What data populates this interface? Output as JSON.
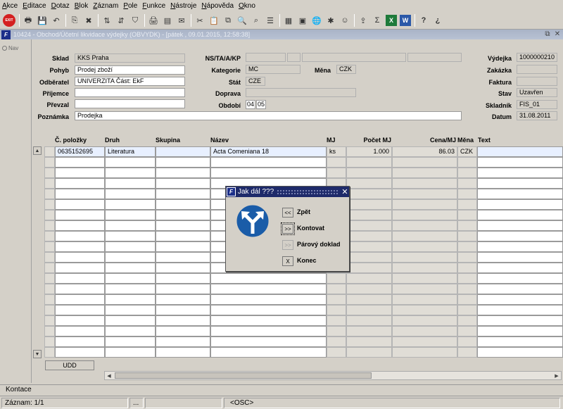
{
  "menu": [
    "Akce",
    "Editace",
    "Dotaz",
    "Blok",
    "Záznam",
    "Pole",
    "Funkce",
    "Nástroje",
    "Nápověda",
    "Okno"
  ],
  "toolbar": {
    "exit_label": "EXIT",
    "icons": [
      "print-icon",
      "save-icon",
      "undo-icon",
      "copy-record-icon",
      "delete-record-icon",
      "sort-icon",
      "sort-desc-icon",
      "filter-icon",
      "printer-icon",
      "report-icon",
      "mail-icon",
      "cut-icon",
      "paste-icon",
      "copy-icon",
      "find-icon",
      "zoom-icon",
      "lov-icon",
      "calc-icon",
      "calendar-icon",
      "globe-icon",
      "settings-icon",
      "contact-icon",
      "export-icon",
      "sigma-icon",
      "excel-icon",
      "word-icon",
      "help-icon",
      "context-help-icon"
    ],
    "glyphs": [
      "🖶",
      "💾",
      "↶",
      "⎘",
      "✖",
      "⇅",
      "⇵",
      "⛉",
      "🖨",
      "▤",
      "✉",
      "✂",
      "📋",
      "⧉",
      "🔍",
      "⌕",
      "☰",
      "▦",
      "▣",
      "🌐",
      "✱",
      "☺",
      "⇪",
      "Σ",
      "X",
      "W",
      "?",
      "¿"
    ]
  },
  "window": {
    "title": "10424 - Obchod/Účetní likvidace výdejky (OBVYDK) - [pátek , 09.01.2015, 12:58:38]",
    "app_icon": "F",
    "restore_glyph": "⧉",
    "close_glyph": "✕"
  },
  "nav": {
    "label": "Nav"
  },
  "form": {
    "sklad": {
      "label": "Sklad",
      "value": "KKS Praha"
    },
    "pohyb": {
      "label": "Pohyb",
      "value": "Prodej zboží"
    },
    "odberatel": {
      "label": "Odběratel",
      "value": "UNIVERZITA Část: EkF"
    },
    "prijemce": {
      "label": "Příjemce",
      "value": ""
    },
    "prevzal": {
      "label": "Převzal",
      "value": ""
    },
    "poznamka": {
      "label": "Poznámka",
      "value": "Prodejka"
    },
    "ns": {
      "label": "NS/TA/A/KP",
      "values": [
        "",
        "",
        "",
        ""
      ]
    },
    "kategorie": {
      "label": "Kategorie",
      "value": "MC"
    },
    "mena": {
      "label": "Měna",
      "value": "CZK"
    },
    "stat": {
      "label": "Stát",
      "value": "CZE"
    },
    "doprava": {
      "label": "Doprava",
      "value": ""
    },
    "obdobi": {
      "label": "Období",
      "year": "04",
      "month": "05"
    },
    "vydejka": {
      "label": "Výdejka",
      "value": "1000000210"
    },
    "zakazka": {
      "label": "Zakázka",
      "value": ""
    },
    "faktura": {
      "label": "Faktura",
      "value": ""
    },
    "stav": {
      "label": "Stav",
      "value": "Uzavřen"
    },
    "skladnik": {
      "label": "Skladník",
      "value": "FIS_01"
    },
    "datum": {
      "label": "Datum",
      "value": "31.08.2011"
    }
  },
  "grid": {
    "headers": {
      "polozka": "Č. položky",
      "druh": "Druh",
      "skupina": "Skupina",
      "nazev": "Název",
      "mj": "MJ",
      "pocet": "Počet MJ",
      "cena": "Cena/MJ",
      "mena": "Měna",
      "text": "Text"
    },
    "rows": [
      {
        "polozka": "0635152695",
        "druh": "Literatura",
        "skupina": "",
        "nazev": "Acta Comeniana 18",
        "mj": "ks",
        "pocet": "1.000",
        "cena": "86.03",
        "mena": "CZK",
        "text": ""
      }
    ],
    "scroll_up": "▲",
    "scroll_down": "▼",
    "scroll_left": "◀",
    "scroll_right": "▶"
  },
  "udd_button": "UDD",
  "status": {
    "block": "Kontace",
    "record": "Záznam: 1/1",
    "seg2": "...",
    "seg3": "",
    "osc": "<OSC>"
  },
  "dialog": {
    "title": "Jak dál ???",
    "app_icon": "F",
    "close_glyph": "✕",
    "options": [
      {
        "key": "<<",
        "label": "Zpět",
        "enabled": true
      },
      {
        "key": ">>",
        "label": "Kontovat",
        "enabled": true,
        "focused": true
      },
      {
        "key": ">>",
        "label": "Párový doklad",
        "enabled": false
      },
      {
        "key": "X",
        "label": "Konec",
        "enabled": true
      }
    ],
    "colors": {
      "sign_blue": "#1a5ca8",
      "title_bg": "#1e2a6a"
    }
  }
}
